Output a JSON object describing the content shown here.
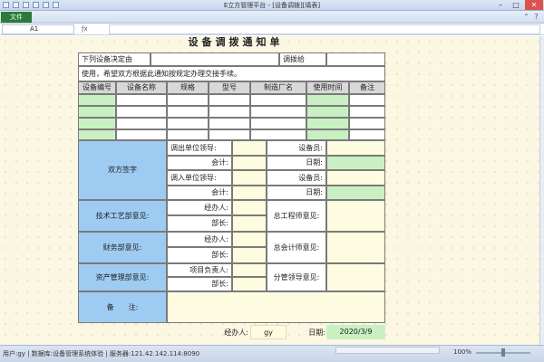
{
  "window": {
    "title": "E立方管理平台 - [设备调拨][填表]",
    "minimize": "–",
    "maximize": "□",
    "close": "✕"
  },
  "ribbon": {
    "file_tab": "文件"
  },
  "formula_bar": {
    "cell_ref": "A1",
    "fx": "ƒx",
    "value": ""
  },
  "form": {
    "title": "设备调拨通知单",
    "row1": {
      "label_left": "下列设备决定由",
      "label_right": "调拨给"
    },
    "notice": "使用，希望双方根据此通知按规定办理交接手续。",
    "columns": [
      "设备编号",
      "设备名称",
      "规格",
      "型号",
      "制造厂名",
      "使用时间",
      "备注"
    ],
    "signature": {
      "section": "双方签字",
      "out_leader": "调出单位领导:",
      "equip_officer_1": "设备员:",
      "accountant_1": "会计:",
      "date_1": "日期:",
      "in_leader": "调入单位领导:",
      "equip_officer_2": "设备员:",
      "accountant_2": "会计:",
      "date_2": "日期:"
    },
    "tech": {
      "section": "技术工艺部意见:",
      "handler": "经办人:",
      "dept_head": "部长:",
      "chief_engineer": "总工程师意见:"
    },
    "finance": {
      "section": "财务部意见:",
      "handler": "经办人:",
      "dept_head": "部长:",
      "chief_accountant": "总会计师意见:"
    },
    "asset": {
      "section": "资产管理部意见:",
      "project_lead": "项目负责人:",
      "dept_head": "部长:",
      "vp_opinion": "分管领导意见:"
    },
    "remark": {
      "label": "备　　注:"
    },
    "footer": {
      "handler_label": "经办人:",
      "handler_value": "gy",
      "date_label": "日期:",
      "date_value": "2020/3/9"
    }
  },
  "status_bar": {
    "text": "用户:gy | 数据库:设备管理系统体验 | 服务器:121.42.142.114:8090",
    "zoom": "100%"
  },
  "colors": {
    "green_cell": "#c9f0c3",
    "blue_section": "#9ecbf2",
    "grey_header": "#d8d8d8",
    "file_tab": "#2c7a3a"
  }
}
